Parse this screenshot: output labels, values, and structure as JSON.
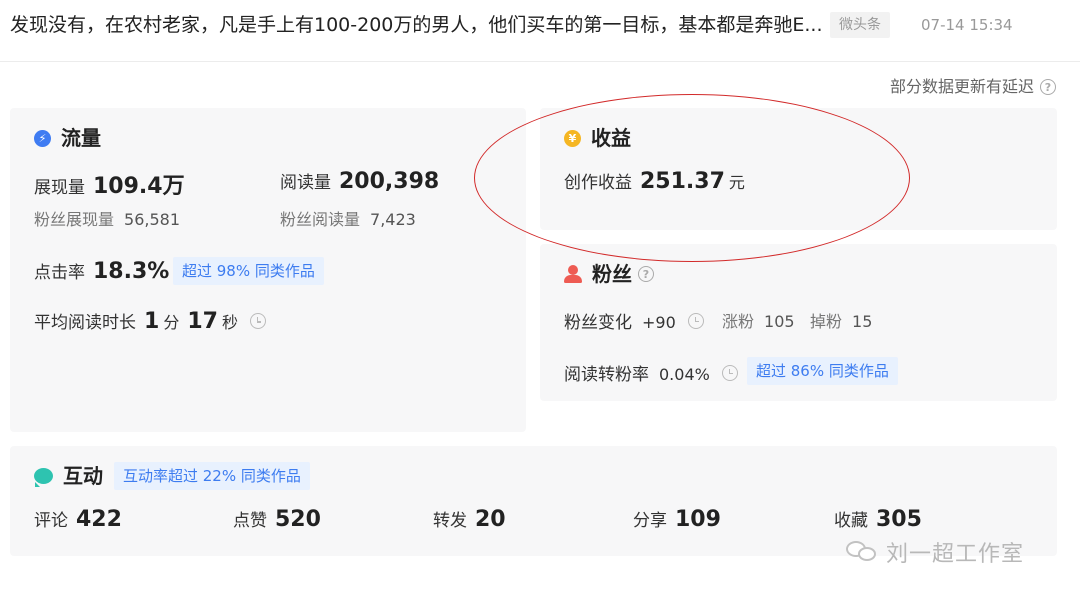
{
  "header": {
    "title": "发现没有，在农村老家，凡是手上有100-200万的男人，他们买车的第一目标，基本都是奔驰E...",
    "badge": "微头条",
    "time": "07-14 15:34"
  },
  "notice": "部分数据更新有延迟",
  "traffic": {
    "title": "流量",
    "impressions_label": "展现量",
    "impressions_value": "109.4万",
    "reads_label": "阅读量",
    "reads_value": "200,398",
    "fan_impressions_label": "粉丝展现量",
    "fan_impressions_value": "56,581",
    "fan_reads_label": "粉丝阅读量",
    "fan_reads_value": "7,423",
    "ctr_label": "点击率",
    "ctr_value": "18.3%",
    "ctr_tag": "超过 98% 同类作品",
    "avg_time_label": "平均阅读时长",
    "avg_time_min": "1",
    "avg_time_min_unit": "分",
    "avg_time_sec": "17",
    "avg_time_sec_unit": "秒"
  },
  "income": {
    "title": "收益",
    "label": "创作收益",
    "value": "251.37",
    "unit": "元"
  },
  "fans": {
    "title": "粉丝",
    "change_label": "粉丝变化",
    "change_value": "+90",
    "gain_label": "涨粉",
    "gain_value": "105",
    "loss_label": "掉粉",
    "loss_value": "15",
    "conversion_label": "阅读转粉率",
    "conversion_value": "0.04%",
    "conversion_tag": "超过 86% 同类作品"
  },
  "interaction": {
    "title": "互动",
    "tag": "互动率超过 22% 同类作品",
    "items": [
      {
        "label": "评论",
        "value": "422"
      },
      {
        "label": "点赞",
        "value": "520"
      },
      {
        "label": "转发",
        "value": "20"
      },
      {
        "label": "分享",
        "value": "109"
      },
      {
        "label": "收藏",
        "value": "305"
      }
    ]
  },
  "watermark": "刘一超工作室",
  "colors": {
    "accent_blue": "#3d7cf0",
    "tag_bg": "#e8f1fe",
    "card_bg": "#f7f7f8",
    "highlight_red": "#d22a2a"
  },
  "icons": {
    "traffic": "lightning-icon",
    "income": "yuan-coin-icon",
    "fans": "person-icon",
    "interaction": "chat-bubble-icon"
  }
}
